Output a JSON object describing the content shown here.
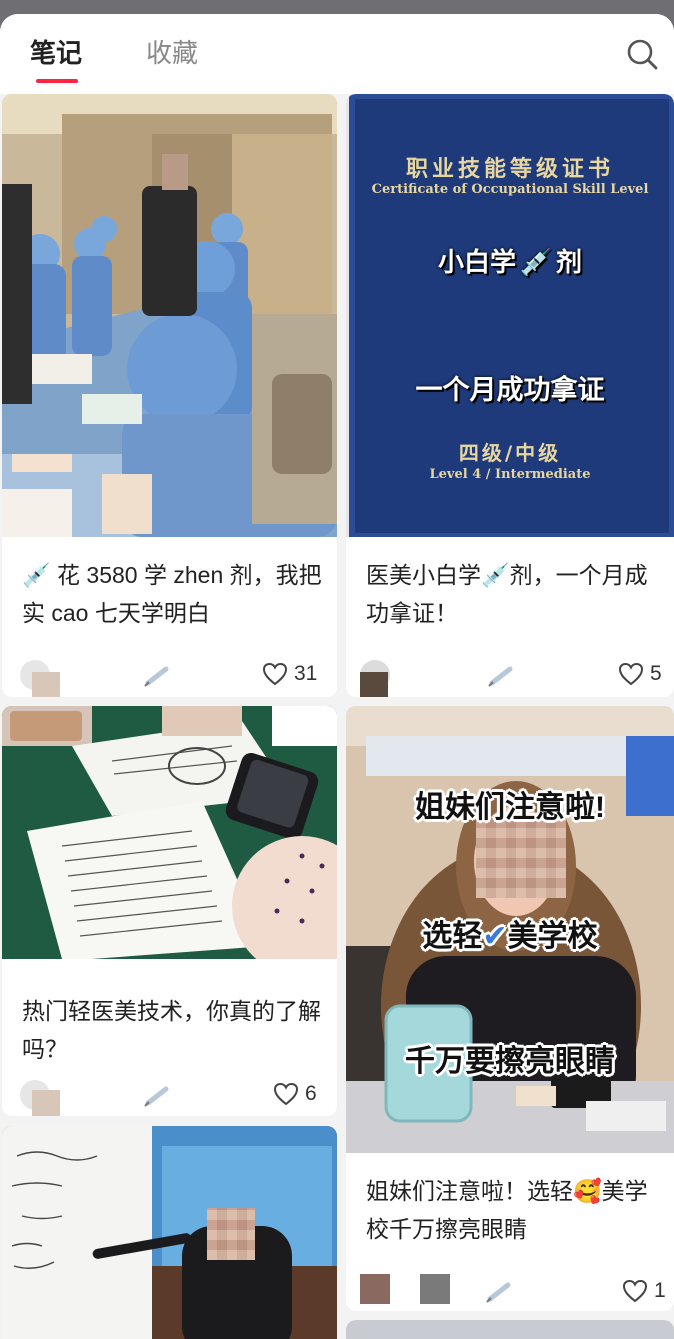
{
  "tabs": {
    "notes": "笔记",
    "favorites": "收藏"
  },
  "icons": {
    "search": "search-icon",
    "like": "heart-outline-icon",
    "syringe": "syringe-emoji"
  },
  "colors": {
    "accent": "#ff2442",
    "certificate_blue": "#1f3a7a",
    "certificate_gold": "#e8d6a0"
  },
  "cards": [
    {
      "title_prefix": "💉",
      "title": "花 3580 学 zhen 剂，我把实 cao 七天学明白",
      "likes": "31"
    },
    {
      "image_text": {
        "cn_title": "职业技能等级证书",
        "en_title": "Certificate of Occupational Skill Level",
        "line1_a": "小白学",
        "line1_b": "剂",
        "line2": "一个月成功拿证",
        "level_cn": "四级/中级",
        "level_en": "Level 4 / Intermediate"
      },
      "title_a": "医美小白学",
      "title_b": "剂，一个月成功拿证！",
      "likes": "5"
    },
    {
      "title": "热门轻医美技术，你真的了解吗？",
      "likes": "6"
    },
    {
      "image_text": {
        "line1": "姐妹们注意啦!",
        "line2_a": "选轻",
        "line2_b": "美学校",
        "line3": "千万要擦亮眼睛"
      },
      "title_a": "姐妹们注意啦！选轻",
      "title_b": "美学校千万擦亮眼睛",
      "likes": "1"
    }
  ]
}
